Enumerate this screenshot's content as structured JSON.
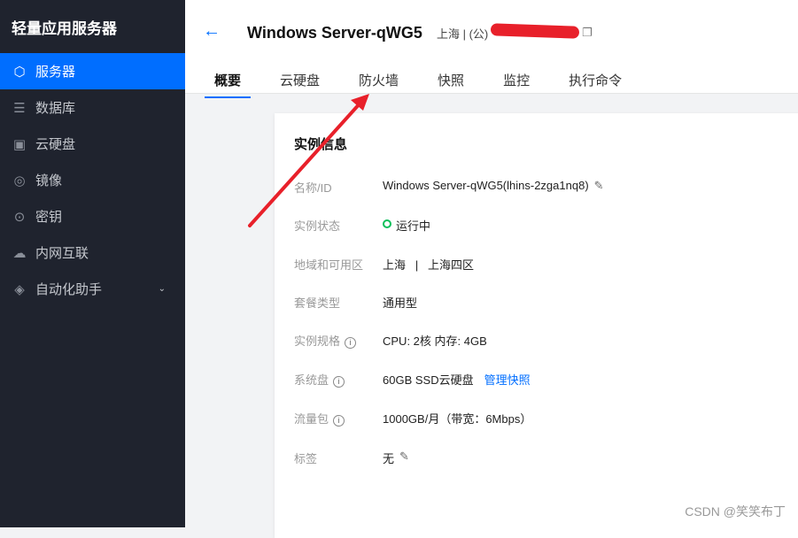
{
  "sidebar": {
    "brand": "轻量应用服务器",
    "items": [
      {
        "label": "服务器",
        "icon": "cube-icon"
      },
      {
        "label": "数据库",
        "icon": "database-icon"
      },
      {
        "label": "云硬盘",
        "icon": "disk-icon"
      },
      {
        "label": "镜像",
        "icon": "image-icon"
      },
      {
        "label": "密钥",
        "icon": "key-icon"
      },
      {
        "label": "内网互联",
        "icon": "network-icon"
      },
      {
        "label": "自动化助手",
        "icon": "automation-icon"
      }
    ]
  },
  "header": {
    "title": "Windows Server-qWG5",
    "region": "上海 | (公)",
    "tabs": [
      "概要",
      "云硬盘",
      "防火墙",
      "快照",
      "监控",
      "执行命令"
    ]
  },
  "card": {
    "title": "实例信息",
    "rows": [
      {
        "label": "名称/ID",
        "value": "Windows Server-qWG5(lhins-2zga1nq8)"
      },
      {
        "label": "实例状态",
        "value": "运行中"
      },
      {
        "label": "地域和可用区",
        "value": "上海   |   上海四区"
      },
      {
        "label": "套餐类型",
        "value": "通用型"
      },
      {
        "label": "实例规格",
        "value": "CPU: 2核 内存: 4GB"
      },
      {
        "label": "系统盘",
        "value": "60GB SSD云硬盘",
        "link": "管理快照"
      },
      {
        "label": "流量包",
        "value": "1000GB/月（带宽：6Mbps）"
      },
      {
        "label": "标签",
        "value": "无"
      }
    ]
  },
  "watermark": "CSDN @笑笑布丁",
  "colors": {
    "accent": "#006eff",
    "sidebar": "#1f232e",
    "running": "#0abf5b",
    "annotation": "#e8202a"
  }
}
